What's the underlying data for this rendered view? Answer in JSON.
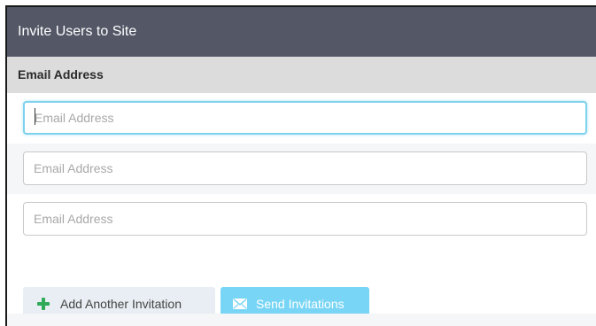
{
  "panel": {
    "title": "Invite Users to Site"
  },
  "table": {
    "column_header": "Email Address"
  },
  "email_fields": [
    {
      "placeholder": "Email Address",
      "value": "",
      "focused": true
    },
    {
      "placeholder": "Email Address",
      "value": "",
      "focused": false
    },
    {
      "placeholder": "Email Address",
      "value": "",
      "focused": false
    }
  ],
  "actions": {
    "add_label": "Add Another Invitation",
    "add_icon": "plus-icon",
    "send_label": "Send Invitations",
    "send_icon": "envelope-icon"
  },
  "colors": {
    "header_bg": "#535766",
    "column_header_bg": "#dcdcdc",
    "focus_border": "#7dd2ee",
    "add_icon": "#2eaa58",
    "send_button_bg": "#78d5f5"
  }
}
